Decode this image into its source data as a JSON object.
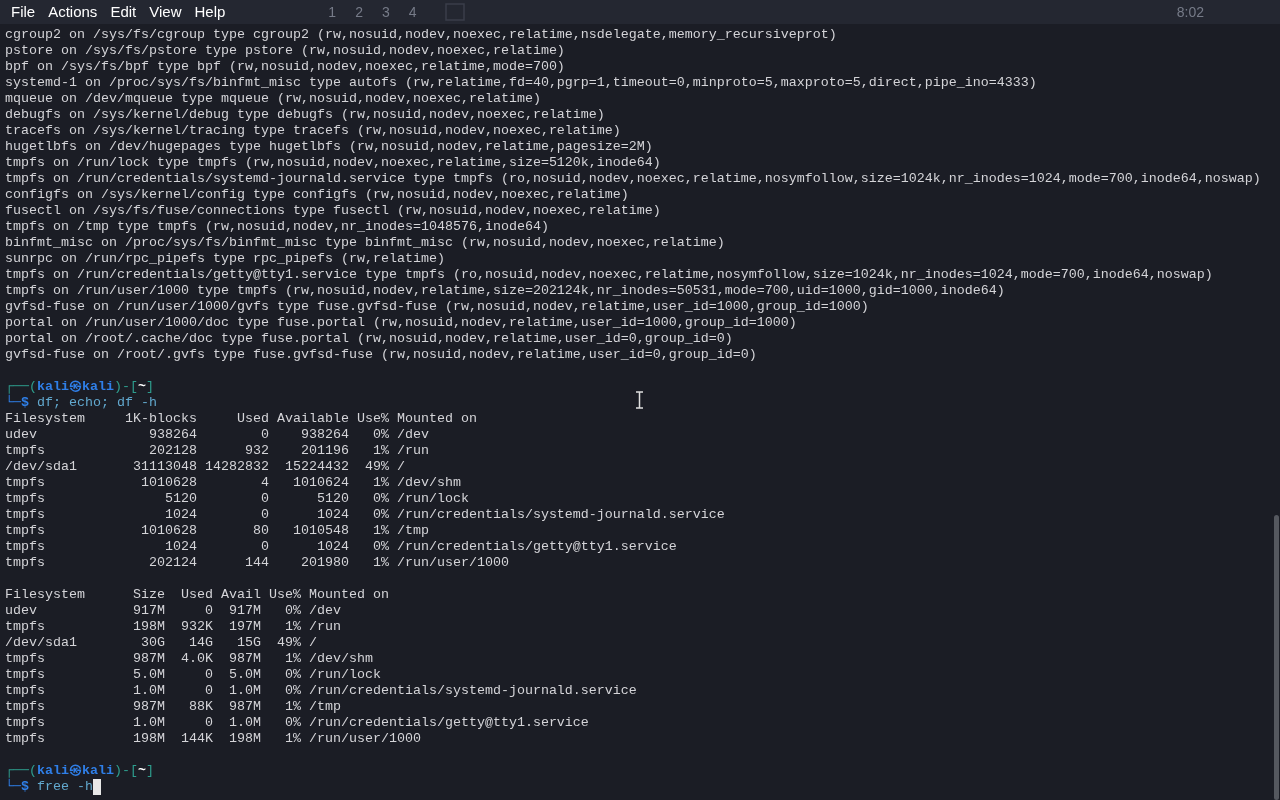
{
  "menu": [
    "File",
    "Actions",
    "Edit",
    "View",
    "Help"
  ],
  "panel_behind": {
    "workspaces": [
      "1",
      "2",
      "3",
      "4"
    ],
    "clock": "8:02"
  },
  "lines": [
    {
      "kind": "output",
      "text": "cgroup2 on /sys/fs/cgroup type cgroup2 (rw,nosuid,nodev,noexec,relatime,nsdelegate,memory_recursiveprot)"
    },
    {
      "kind": "output",
      "text": "pstore on /sys/fs/pstore type pstore (rw,nosuid,nodev,noexec,relatime)"
    },
    {
      "kind": "output",
      "text": "bpf on /sys/fs/bpf type bpf (rw,nosuid,nodev,noexec,relatime,mode=700)"
    },
    {
      "kind": "output",
      "text": "systemd-1 on /proc/sys/fs/binfmt_misc type autofs (rw,relatime,fd=40,pgrp=1,timeout=0,minproto=5,maxproto=5,direct,pipe_ino=4333)"
    },
    {
      "kind": "output",
      "text": "mqueue on /dev/mqueue type mqueue (rw,nosuid,nodev,noexec,relatime)"
    },
    {
      "kind": "output",
      "text": "debugfs on /sys/kernel/debug type debugfs (rw,nosuid,nodev,noexec,relatime)"
    },
    {
      "kind": "output",
      "text": "tracefs on /sys/kernel/tracing type tracefs (rw,nosuid,nodev,noexec,relatime)"
    },
    {
      "kind": "output",
      "text": "hugetlbfs on /dev/hugepages type hugetlbfs (rw,nosuid,nodev,relatime,pagesize=2M)"
    },
    {
      "kind": "output",
      "text": "tmpfs on /run/lock type tmpfs (rw,nosuid,nodev,noexec,relatime,size=5120k,inode64)"
    },
    {
      "kind": "output",
      "text": "tmpfs on /run/credentials/systemd-journald.service type tmpfs (ro,nosuid,nodev,noexec,relatime,nosymfollow,size=1024k,nr_inodes=1024,mode=700,inode64,noswap)"
    },
    {
      "kind": "output",
      "text": "configfs on /sys/kernel/config type configfs (rw,nosuid,nodev,noexec,relatime)"
    },
    {
      "kind": "output",
      "text": "fusectl on /sys/fs/fuse/connections type fusectl (rw,nosuid,nodev,noexec,relatime)"
    },
    {
      "kind": "output",
      "text": "tmpfs on /tmp type tmpfs (rw,nosuid,nodev,nr_inodes=1048576,inode64)"
    },
    {
      "kind": "output",
      "text": "binfmt_misc on /proc/sys/fs/binfmt_misc type binfmt_misc (rw,nosuid,nodev,noexec,relatime)"
    },
    {
      "kind": "output",
      "text": "sunrpc on /run/rpc_pipefs type rpc_pipefs (rw,relatime)"
    },
    {
      "kind": "output",
      "text": "tmpfs on /run/credentials/getty@tty1.service type tmpfs (ro,nosuid,nodev,noexec,relatime,nosymfollow,size=1024k,nr_inodes=1024,mode=700,inode64,noswap)"
    },
    {
      "kind": "output",
      "text": "tmpfs on /run/user/1000 type tmpfs (rw,nosuid,nodev,relatime,size=202124k,nr_inodes=50531,mode=700,uid=1000,gid=1000,inode64)"
    },
    {
      "kind": "output",
      "text": "gvfsd-fuse on /run/user/1000/gvfs type fuse.gvfsd-fuse (rw,nosuid,nodev,relatime,user_id=1000,group_id=1000)"
    },
    {
      "kind": "output",
      "text": "portal on /run/user/1000/doc type fuse.portal (rw,nosuid,nodev,relatime,user_id=1000,group_id=1000)"
    },
    {
      "kind": "output",
      "text": "portal on /root/.cache/doc type fuse.portal (rw,nosuid,nodev,relatime,user_id=0,group_id=0)"
    },
    {
      "kind": "output",
      "text": "gvfsd-fuse on /root/.gvfs type fuse.gvfsd-fuse (rw,nosuid,nodev,relatime,user_id=0,group_id=0)"
    },
    {
      "kind": "blank"
    },
    {
      "kind": "prompt",
      "open": "┌──(",
      "user": "kali㉿kali",
      "mid": ")-[",
      "dir": "~",
      "close": "]",
      "sign": "└─$",
      "command": "df; echo; df -h",
      "cursor": false
    },
    {
      "kind": "output",
      "text": "Filesystem     1K-blocks     Used Available Use% Mounted on"
    },
    {
      "kind": "output",
      "text": "udev              938264        0    938264   0% /dev"
    },
    {
      "kind": "output",
      "text": "tmpfs             202128      932    201196   1% /run"
    },
    {
      "kind": "output",
      "text": "/dev/sda1       31113048 14282832  15224432  49% /"
    },
    {
      "kind": "output",
      "text": "tmpfs            1010628        4   1010624   1% /dev/shm"
    },
    {
      "kind": "output",
      "text": "tmpfs               5120        0      5120   0% /run/lock"
    },
    {
      "kind": "output",
      "text": "tmpfs               1024        0      1024   0% /run/credentials/systemd-journald.service"
    },
    {
      "kind": "output",
      "text": "tmpfs            1010628       80   1010548   1% /tmp"
    },
    {
      "kind": "output",
      "text": "tmpfs               1024        0      1024   0% /run/credentials/getty@tty1.service"
    },
    {
      "kind": "output",
      "text": "tmpfs             202124      144    201980   1% /run/user/1000"
    },
    {
      "kind": "blank"
    },
    {
      "kind": "output",
      "text": "Filesystem      Size  Used Avail Use% Mounted on"
    },
    {
      "kind": "output",
      "text": "udev            917M     0  917M   0% /dev"
    },
    {
      "kind": "output",
      "text": "tmpfs           198M  932K  197M   1% /run"
    },
    {
      "kind": "output",
      "text": "/dev/sda1        30G   14G   15G  49% /"
    },
    {
      "kind": "output",
      "text": "tmpfs           987M  4.0K  987M   1% /dev/shm"
    },
    {
      "kind": "output",
      "text": "tmpfs           5.0M     0  5.0M   0% /run/lock"
    },
    {
      "kind": "output",
      "text": "tmpfs           1.0M     0  1.0M   0% /run/credentials/systemd-journald.service"
    },
    {
      "kind": "output",
      "text": "tmpfs           987M   88K  987M   1% /tmp"
    },
    {
      "kind": "output",
      "text": "tmpfs           1.0M     0  1.0M   0% /run/credentials/getty@tty1.service"
    },
    {
      "kind": "output",
      "text": "tmpfs           198M  144K  198M   1% /run/user/1000"
    },
    {
      "kind": "blank"
    },
    {
      "kind": "prompt",
      "open": "┌──(",
      "user": "kali㉿kali",
      "mid": ")-[",
      "dir": "~",
      "close": "]",
      "sign": "└─$",
      "command": "free -h",
      "cursor": true
    }
  ]
}
